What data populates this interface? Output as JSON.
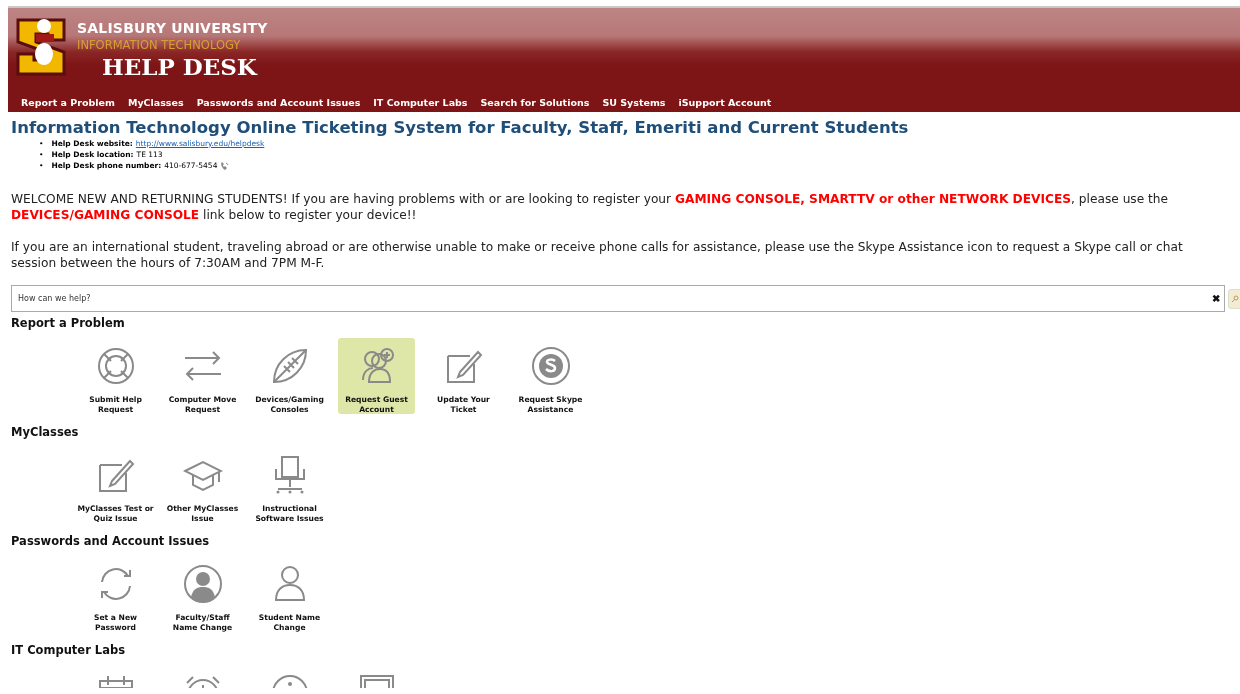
{
  "header": {
    "university": "SALISBURY UNIVERSITY",
    "department": "INFORMATION TECHNOLOGY",
    "title": "HELP DESK"
  },
  "nav": [
    "Report a Problem",
    "MyClasses",
    "Passwords and Account Issues",
    "IT Computer Labs",
    "Search for Solutions",
    "SU Systems",
    "iSupport Account"
  ],
  "page_title": "Information Technology Online Ticketing System for Faculty, Staff, Emeriti and Current Students",
  "contacts": [
    {
      "marker": "•",
      "label": "Help Desk website:",
      "value": "http://www.salisbury.edu/helpdesk",
      "kind": "link"
    },
    {
      "marker": "•",
      "label": "Help Desk location:",
      "value": "TE 113",
      "kind": "text"
    },
    {
      "marker": "•",
      "label": "Help Desk phone number:",
      "value": "410-677-5454",
      "kind": "phone"
    }
  ],
  "notices": [
    "WELCOME NEW AND RETURNING STUDENTS! If you are having problems with or are looking to register your **GAMING CONSOLE, SMARTTV or other NETWORK DEVICES**, please use the **DEVICES/GAMING CONSOLE** link below to register your device!!",
    "If you are an international student, traveling abroad or are otherwise unable to make or receive phone calls for assistance, please use the Skype Assistance icon to request a Skype call or chat session between the hours of 7:30AM and 7PM M-F."
  ],
  "search": {
    "placeholder": "How can we help?",
    "clear": "✖"
  },
  "sections": [
    {
      "title": "Report a Problem",
      "tiles": [
        {
          "label": "Submit Help Request",
          "highlighted": false
        },
        {
          "label": "Computer Move Request",
          "highlighted": false
        },
        {
          "label": "Devices/Gaming Consoles",
          "highlighted": false
        },
        {
          "label": "Request Guest Account",
          "highlighted": true
        },
        {
          "label": "Update Your Ticket",
          "highlighted": false
        },
        {
          "label": "Request Skype Assistance",
          "highlighted": false
        }
      ]
    },
    {
      "title": "MyClasses",
      "tiles": [
        {
          "label": "MyClasses Test or Quiz Issue",
          "highlighted": false
        },
        {
          "label": "Other MyClasses Issue",
          "highlighted": false
        },
        {
          "label": "Instructional Software Issues",
          "highlighted": false
        }
      ]
    },
    {
      "title": "Passwords and Account Issues",
      "tiles": [
        {
          "label": "Set a New Password",
          "highlighted": false
        },
        {
          "label": "Faculty/Staff Name Change",
          "highlighted": false
        },
        {
          "label": "Student Name Change",
          "highlighted": false
        }
      ]
    },
    {
      "title": "IT Computer Labs",
      "tiles": [
        {
          "highlighted": false
        },
        {
          "highlighted": false
        },
        {
          "highlighted": false
        },
        {
          "highlighted": false
        }
      ]
    }
  ]
}
